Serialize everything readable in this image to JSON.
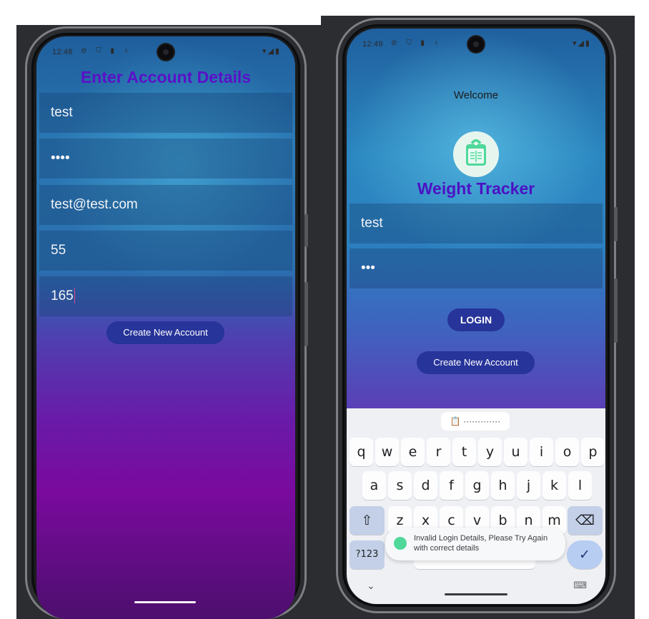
{
  "left_phone": {
    "status": {
      "time": "12:48",
      "icons": "⊘ ⛉ ▮ ♁",
      "right": "▾◢▮"
    },
    "title": "Enter Account Details",
    "fields": [
      {
        "name": "username-field",
        "value": "test"
      },
      {
        "name": "password-field",
        "value": "••••"
      },
      {
        "name": "email-field",
        "value": "test@test.com"
      },
      {
        "name": "weight-field",
        "value": "55"
      },
      {
        "name": "height-field",
        "value": "165"
      }
    ],
    "create_button": "Create New Account"
  },
  "right_phone": {
    "status": {
      "time": "12:49",
      "icons": "⊘ ⛉ ▮ ♁",
      "right": "▾◢▮"
    },
    "welcome": "Welcome",
    "app_title": "Weight Tracker",
    "username_value": "test",
    "password_value": "•••",
    "login_button": "LOGIN",
    "create_button": "Create New Account",
    "clipboard_suggestion": "·············",
    "keyboard": {
      "row1": [
        "q",
        "w",
        "e",
        "r",
        "t",
        "y",
        "u",
        "i",
        "o",
        "p"
      ],
      "row2": [
        "a",
        "s",
        "d",
        "f",
        "g",
        "h",
        "j",
        "k",
        "l"
      ],
      "row3": [
        "z",
        "x",
        "c",
        "v",
        "b",
        "n",
        "m"
      ],
      "symbols_key": "?123",
      "shift_icon": "⇧",
      "backspace_icon": "⌫",
      "enter_icon": "✓",
      "collapse_icon": "⌄",
      "keyboard_icon": "⌨"
    },
    "toast": {
      "line1": "Invalid Login Details, Please Try Again",
      "line2": "with correct details"
    }
  },
  "colors": {
    "title_purple": "#5a10c8",
    "button_navy": "#27349a",
    "icon_green": "#4fd89a"
  }
}
